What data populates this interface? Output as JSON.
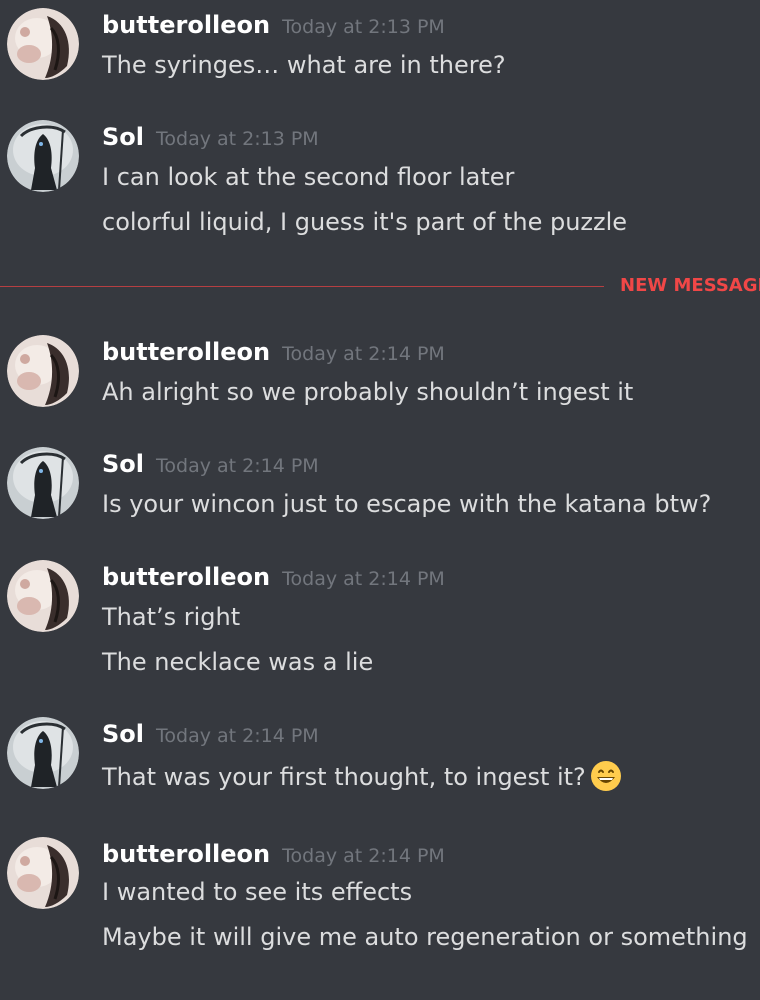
{
  "messages": [
    {
      "author": "butterolleon",
      "avatar_icon": "butterolleon-avatar-icon",
      "timestamp": "Today at 2:13 PM",
      "lines": [
        "The syringes… what are in there?"
      ]
    },
    {
      "author": "Sol",
      "avatar_icon": "sol-reaper-avatar-icon",
      "timestamp": "Today at 2:13 PM",
      "lines": [
        "I can look at the second floor later",
        "colorful liquid, I guess it's part of the puzzle"
      ]
    },
    {
      "author": "butterolleon",
      "avatar_icon": "butterolleon-avatar-icon",
      "timestamp": "Today at 2:14 PM",
      "lines": [
        "Ah alright so we probably shouldn’t ingest it"
      ]
    },
    {
      "author": "Sol",
      "avatar_icon": "sol-reaper-avatar-icon",
      "timestamp": "Today at 2:14 PM",
      "lines": [
        "Is your wincon just to escape with the katana btw?"
      ]
    },
    {
      "author": "butterolleon",
      "avatar_icon": "butterolleon-avatar-icon",
      "timestamp": "Today at 2:14 PM",
      "lines": [
        "That’s right",
        "The necklace was a lie"
      ]
    },
    {
      "author": "Sol",
      "avatar_icon": "sol-reaper-avatar-icon",
      "timestamp": "Today at 2:14 PM",
      "lines": [
        "That was your first thought, to ingest it?"
      ],
      "emoji": "grinning-face-emoji"
    },
    {
      "author": "butterolleon",
      "avatar_icon": "butterolleon-avatar-icon",
      "timestamp": "Today at 2:14 PM",
      "lines": [
        "I wanted to see its effects",
        "Maybe it will give me auto regeneration or something"
      ]
    }
  ],
  "divider": {
    "label": "NEW MESSAGE",
    "color": "#f04747"
  },
  "colors": {
    "background": "#36393f",
    "username": "#ffffff",
    "timestamp": "#72767d",
    "message_text": "#dcddde"
  }
}
